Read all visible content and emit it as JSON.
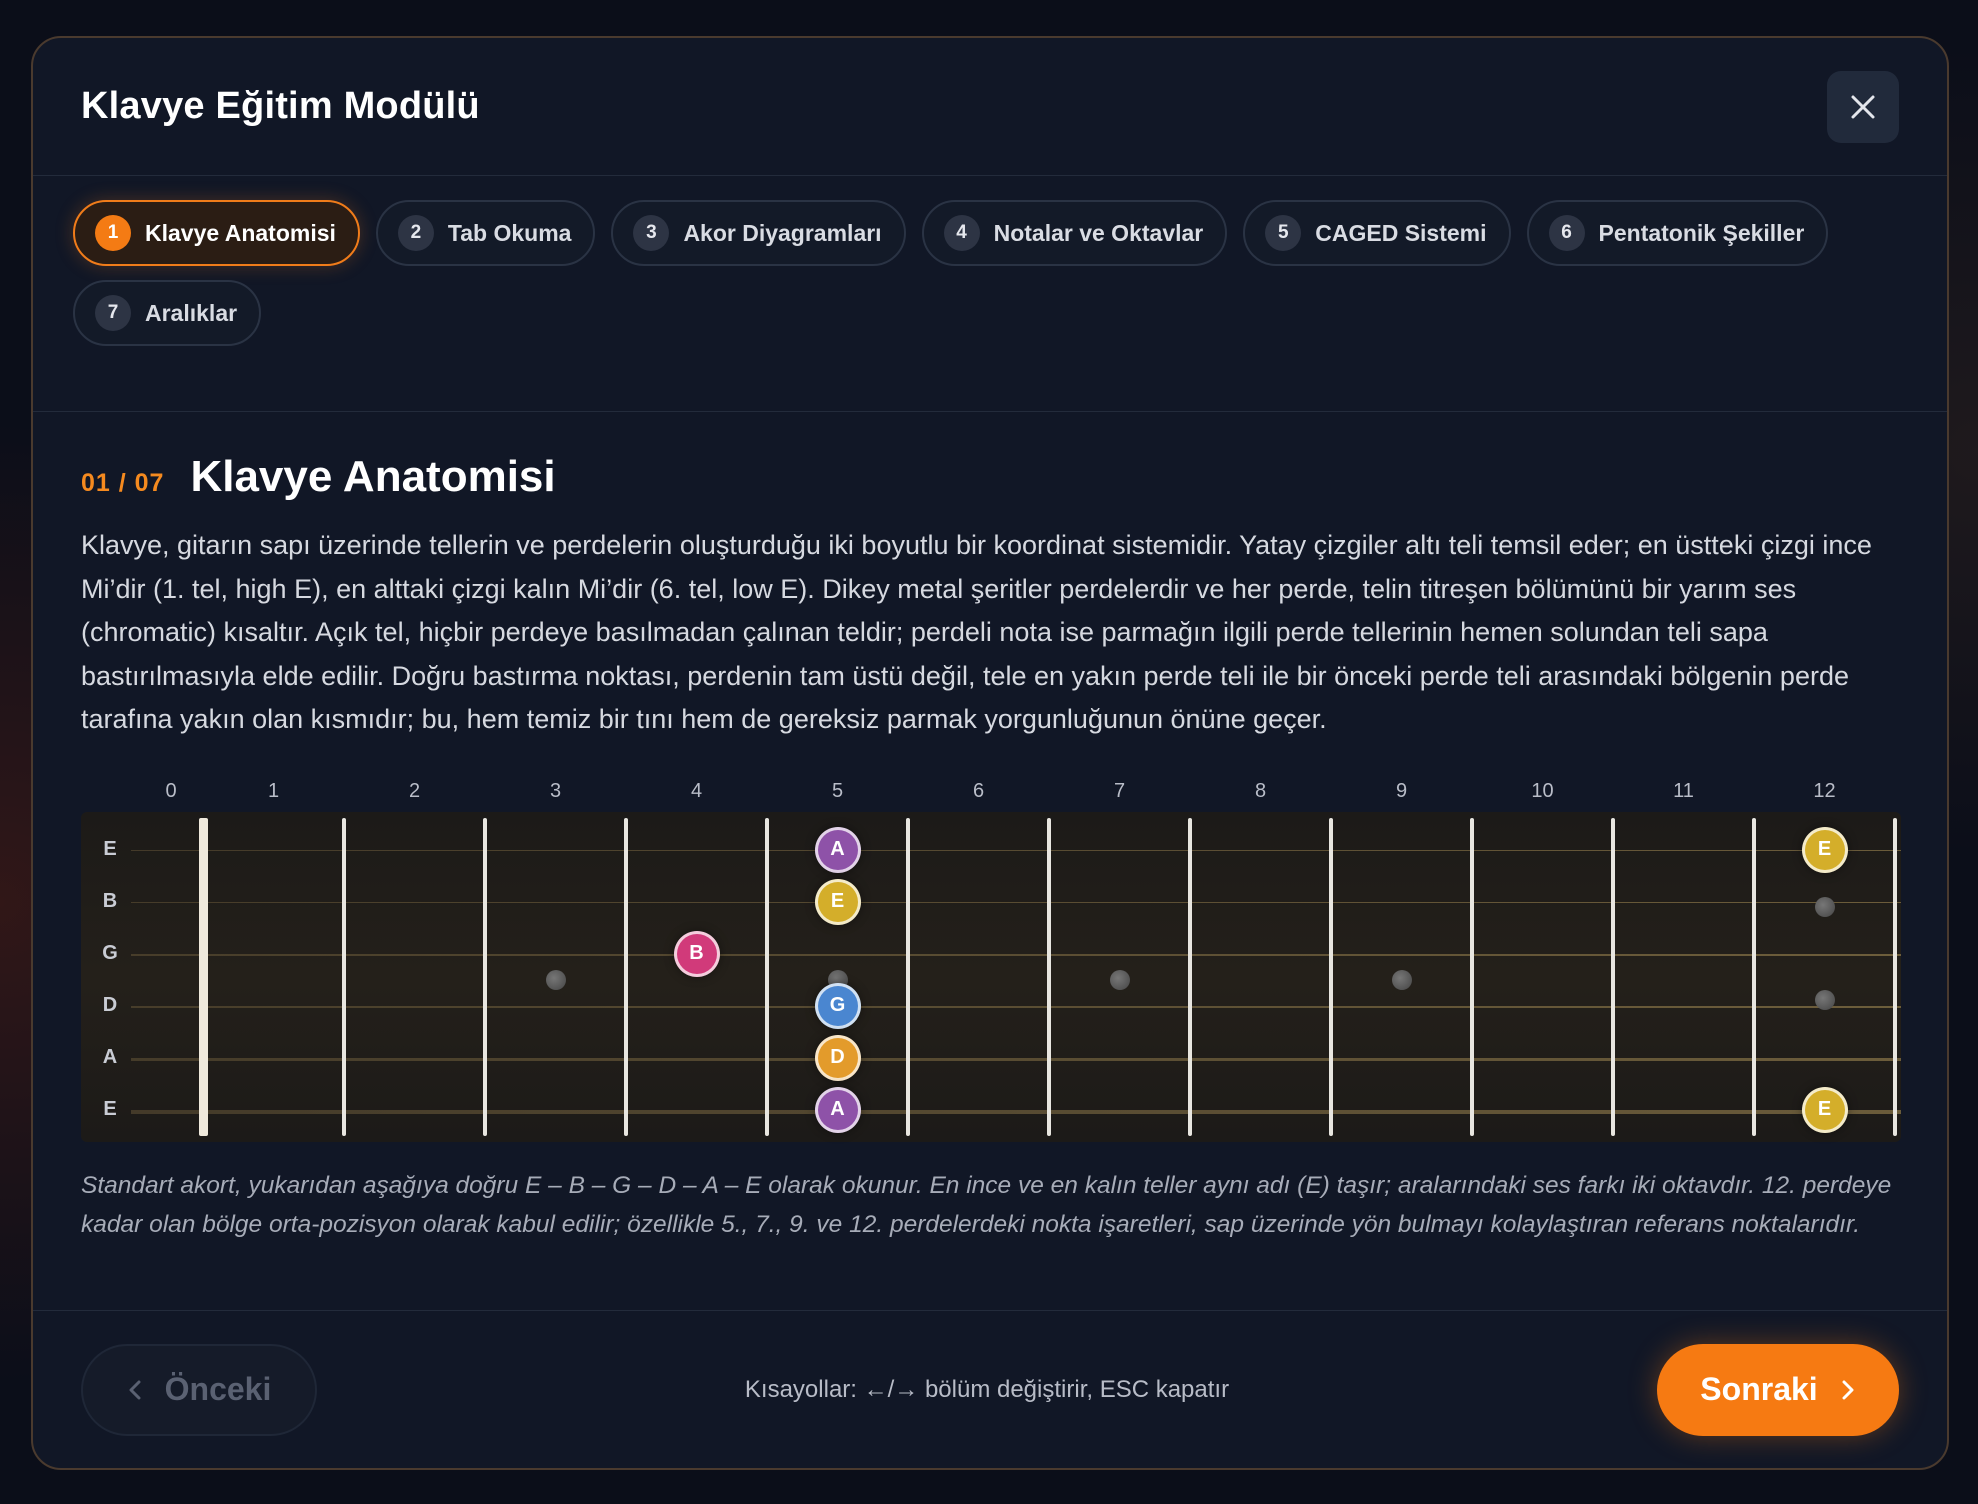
{
  "header": {
    "title": "Klavye Eğitim Modülü",
    "close_icon": "close-icon"
  },
  "tabs": [
    {
      "num": "1",
      "label": "Klavye Anatomisi",
      "active": true
    },
    {
      "num": "2",
      "label": "Tab Okuma",
      "active": false
    },
    {
      "num": "3",
      "label": "Akor Diyagramları",
      "active": false
    },
    {
      "num": "4",
      "label": "Notalar ve Oktavlar",
      "active": false
    },
    {
      "num": "5",
      "label": "CAGED Sistemi",
      "active": false
    },
    {
      "num": "6",
      "label": "Pentatonik Şekiller",
      "active": false
    },
    {
      "num": "7",
      "label": "Aralıklar",
      "active": false
    }
  ],
  "section": {
    "counter": "01 / 07",
    "title": "Klavye Anatomisi",
    "body": "Klavye, gitarın sapı üzerinde tellerin ve perdelerin oluşturduğu iki boyutlu bir koordinat sistemidir. Yatay çizgiler altı teli temsil eder; en üstteki çizgi ince Mi’dir (1. tel, high E), en alttaki çizgi kalın Mi’dir (6. tel, low E). Dikey metal şeritler perdelerdir ve her perde, telin titreşen bölümünü bir yarım ses (chromatic) kısaltır. Açık tel, hiçbir perdeye basılmadan çalınan teldir; perdeli nota ise parmağın ilgili perde tellerinin hemen solundan teli sapa bastırılmasıyla elde edilir. Doğru bastırma noktası, perdenin tam üstü değil, tele en yakın perde teli ile bir önceki perde teli arasındaki bölgenin perde tarafına yakın olan kısmıdır; bu, hem temiz bir tını hem de gereksiz parmak yorgunluğunun önüne geçer.",
    "caption": "Standart akort, yukarıdan aşağıya doğru E – B – G – D – A – E olarak okunur. En ince ve en kalın teller aynı adı (E) taşır; aralarındaki ses farkı iki oktavdır. 12. perdeye kadar olan bölge orta-pozisyon olarak kabul edilir; özellikle 5., 7., 9. ve 12. perdelerdeki nokta işaretleri, sap üzerinde yön bulmayı kolaylaştıran referans noktalarıdır."
  },
  "fretboard": {
    "fret_numbers": [
      "0",
      "1",
      "2",
      "3",
      "4",
      "5",
      "6",
      "7",
      "8",
      "9",
      "10",
      "11",
      "12"
    ],
    "strings": [
      "E",
      "B",
      "G",
      "D",
      "A",
      "E"
    ],
    "inlays": [
      {
        "fret": 3,
        "pos": 3.0
      },
      {
        "fret": 5,
        "pos": 3.0
      },
      {
        "fret": 7,
        "pos": 3.0
      },
      {
        "fret": 9,
        "pos": 3.0
      },
      {
        "fret": 12,
        "pos": 1.6
      },
      {
        "fret": 12,
        "pos": 3.4
      }
    ],
    "notes": [
      {
        "fret": 5,
        "string": 0,
        "label": "A",
        "color": "#8e52a8"
      },
      {
        "fret": 5,
        "string": 1,
        "label": "E",
        "color": "#d4ae2a"
      },
      {
        "fret": 4,
        "string": 2,
        "label": "B",
        "color": "#d13a7a"
      },
      {
        "fret": 5,
        "string": 3,
        "label": "G",
        "color": "#4a86d0"
      },
      {
        "fret": 5,
        "string": 4,
        "label": "D",
        "color": "#e39b2b"
      },
      {
        "fret": 5,
        "string": 5,
        "label": "A",
        "color": "#8e52a8"
      },
      {
        "fret": 12,
        "string": 0,
        "label": "E",
        "color": "#d4ae2a"
      },
      {
        "fret": 12,
        "string": 5,
        "label": "E",
        "color": "#d4ae2a"
      }
    ]
  },
  "footer": {
    "prev_label": "Önceki",
    "shortcut_text": "Kısayollar: ←/→ bölüm değiştirir, ESC kapatır",
    "next_label": "Sonraki"
  },
  "colors": {
    "accent": "#f67a12",
    "background": "#111726"
  }
}
